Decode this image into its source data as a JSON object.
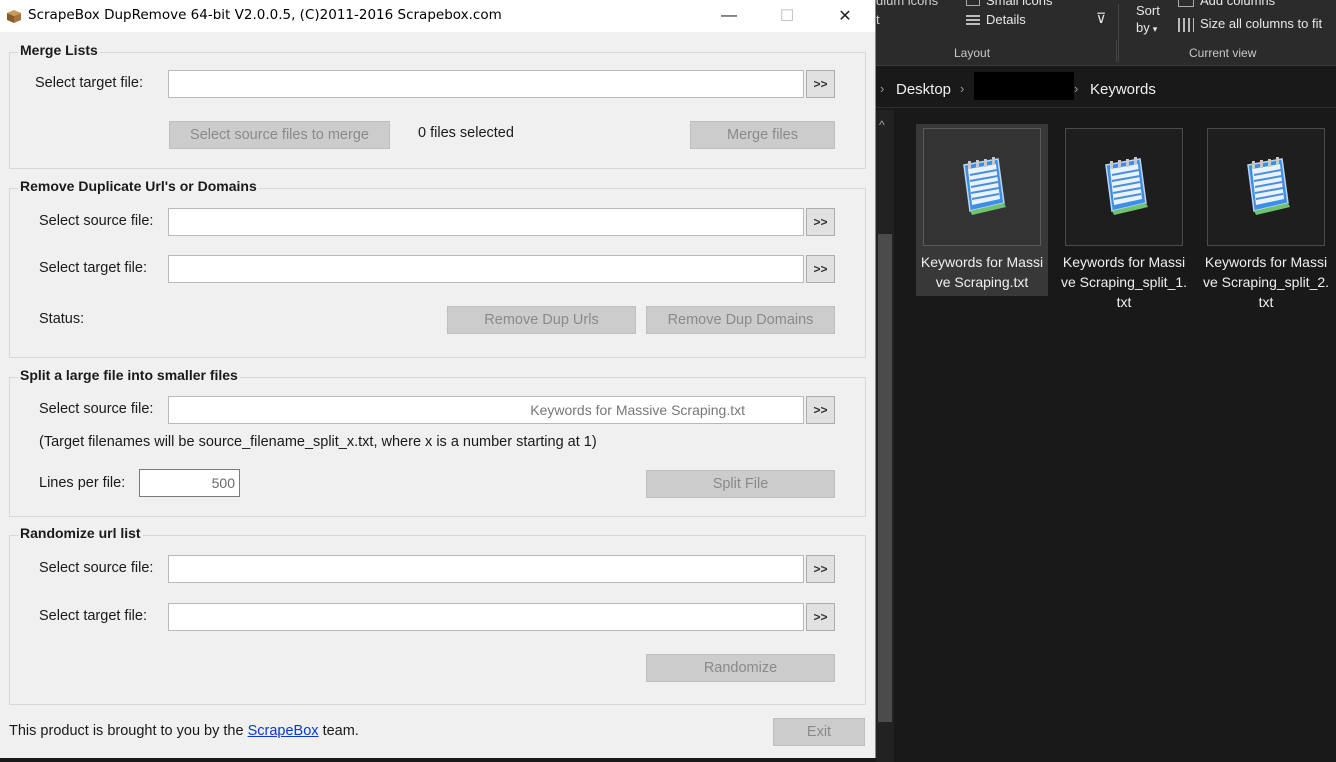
{
  "window": {
    "title": "ScrapeBox DupRemove 64-bit V2.0.0.5, (C)2011-2016 Scrapebox.com",
    "minimize": "—",
    "maximize": "☐",
    "close": "✕"
  },
  "merge": {
    "title": "Merge Lists",
    "target_label": "Select target file:",
    "target_value": "",
    "browse": ">>",
    "select_sources_button": "Select source files to merge",
    "files_selected": "0 files selected",
    "merge_button": "Merge files"
  },
  "dedupe": {
    "title": "Remove Duplicate Url's or Domains",
    "source_label": "Select source file:",
    "source_value": "",
    "target_label": "Select target file:",
    "target_value": "",
    "browse": ">>",
    "status_label": "Status:",
    "remove_urls_button": "Remove Dup Urls",
    "remove_domains_button": "Remove Dup Domains"
  },
  "split": {
    "title": "Split a large file into smaller files",
    "source_label": "Select source file:",
    "source_value": "Keywords for Massive Scraping.txt",
    "browse": ">>",
    "note": "(Target filenames will be source_filename_split_x.txt, where x is a number starting at 1)",
    "lines_label": "Lines per file:",
    "lines_value": "500",
    "split_button": "Split File"
  },
  "randomize": {
    "title": "Randomize url list",
    "source_label": "Select source file:",
    "source_value": "",
    "target_label": "Select target file:",
    "target_value": "",
    "browse": ">>",
    "randomize_button": "Randomize"
  },
  "footer": {
    "text_before": "This product is brought to you by the",
    "link": "ScrapeBox",
    "text_after": "team.",
    "exit_button": "Exit"
  },
  "explorer": {
    "ribbon": {
      "partial_left_top": "dium icons",
      "partial_left_mid": "t",
      "small_icons": "Small icons",
      "details": "Details",
      "sort_by_1": "Sort",
      "sort_by_2": "by",
      "add_columns": "Add columns",
      "size_all_columns": "Size all columns to fit",
      "layout_group": "Layout",
      "current_view_group": "Current view"
    },
    "breadcrumb": {
      "desktop": "Desktop",
      "keywords": "Keywords",
      "separator": "›"
    },
    "files": [
      {
        "name": "Keywords for Massive Scraping.txt",
        "selected": true
      },
      {
        "name": "Keywords for Massive Scraping_split_1.txt",
        "selected": false
      },
      {
        "name": "Keywords for Massive Scraping_split_2.txt",
        "selected": false
      }
    ]
  }
}
